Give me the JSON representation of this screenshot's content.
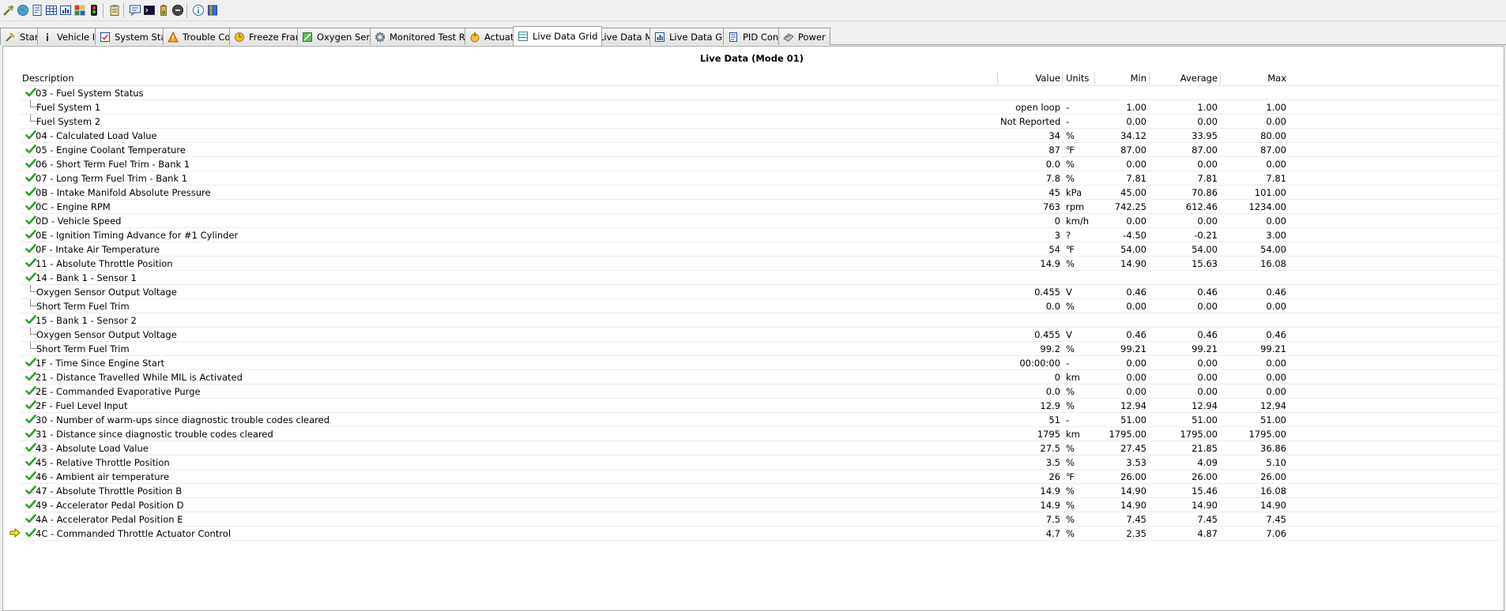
{
  "toolbar": {
    "icons": [
      "connect-icon",
      "globe-icon",
      "report-icon",
      "grid-icon",
      "table-icon",
      "chart-color-icon",
      "dollar-icon",
      "clipboard-icon",
      "chat-icon",
      "terminal-icon",
      "battery-icon",
      "stop-icon",
      "info-icon",
      "book-icon"
    ]
  },
  "tabs": [
    {
      "label": "Start",
      "icon": "start-icon"
    },
    {
      "label": "Vehicle Info",
      "icon": "info-icon"
    },
    {
      "label": "System Status",
      "icon": "status-icon"
    },
    {
      "label": "Trouble Codes",
      "icon": "warning-icon"
    },
    {
      "label": "Freeze Frames",
      "icon": "freeze-icon"
    },
    {
      "label": "Oxygen Sensors",
      "icon": "sensor-icon"
    },
    {
      "label": "Monitored Test Results",
      "icon": "gear-icon"
    },
    {
      "label": "Actuator",
      "icon": "actuator-icon"
    },
    {
      "label": "Live Data Grid",
      "icon": "grid-icon",
      "active": true
    },
    {
      "label": "Live Data Meter",
      "icon": "meter-icon"
    },
    {
      "label": "Live Data Graph",
      "icon": "graph-icon"
    },
    {
      "label": "PID Config",
      "icon": "config-icon"
    },
    {
      "label": "Power",
      "icon": "power-icon"
    }
  ],
  "grid": {
    "title": "Live Data (Mode 01)",
    "columns": {
      "description": "Description",
      "value": "Value",
      "units": "Units",
      "min": "Min",
      "average": "Average",
      "max": "Max"
    },
    "rows": [
      {
        "desc": "03 - Fuel System Status",
        "value": "",
        "units": "",
        "min": "",
        "avg": "",
        "max": "",
        "checked": true
      },
      {
        "desc": "Fuel System 1",
        "value": "open loop",
        "units": "-",
        "min": "1.00",
        "avg": "1.00",
        "max": "1.00",
        "child": true
      },
      {
        "desc": "Fuel System 2",
        "value": "Not Reported",
        "units": "-",
        "min": "0.00",
        "avg": "0.00",
        "max": "0.00",
        "child": true
      },
      {
        "desc": "04 - Calculated Load Value",
        "value": "34",
        "units": "%",
        "min": "34.12",
        "avg": "33.95",
        "max": "80.00",
        "checked": true
      },
      {
        "desc": "05 - Engine Coolant Temperature",
        "value": "87",
        "units": "℉",
        "min": "87.00",
        "avg": "87.00",
        "max": "87.00",
        "checked": true
      },
      {
        "desc": "06 - Short Term Fuel Trim - Bank 1",
        "value": "0.0",
        "units": "%",
        "min": "0.00",
        "avg": "0.00",
        "max": "0.00",
        "checked": true
      },
      {
        "desc": "07 - Long Term Fuel Trim - Bank 1",
        "value": "7.8",
        "units": "%",
        "min": "7.81",
        "avg": "7.81",
        "max": "7.81",
        "checked": true
      },
      {
        "desc": "0B - Intake Manifold Absolute Pressure",
        "value": "45",
        "units": "kPa",
        "min": "45.00",
        "avg": "70.86",
        "max": "101.00",
        "checked": true
      },
      {
        "desc": "0C - Engine RPM",
        "value": "763",
        "units": "rpm",
        "min": "742.25",
        "avg": "612.46",
        "max": "1234.00",
        "checked": true
      },
      {
        "desc": "0D - Vehicle Speed",
        "value": "0",
        "units": "km/h",
        "min": "0.00",
        "avg": "0.00",
        "max": "0.00",
        "checked": true
      },
      {
        "desc": "0E - Ignition Timing Advance for #1 Cylinder",
        "value": "3",
        "units": "?",
        "min": "-4.50",
        "avg": "-0.21",
        "max": "3.00",
        "checked": true
      },
      {
        "desc": "0F - Intake Air Temperature",
        "value": "54",
        "units": "℉",
        "min": "54.00",
        "avg": "54.00",
        "max": "54.00",
        "checked": true
      },
      {
        "desc": "11 - Absolute Throttle Position",
        "value": "14.9",
        "units": "%",
        "min": "14.90",
        "avg": "15.63",
        "max": "16.08",
        "checked": true
      },
      {
        "desc": "14 - Bank 1 - Sensor 1",
        "value": "",
        "units": "",
        "min": "",
        "avg": "",
        "max": "",
        "checked": true
      },
      {
        "desc": "Oxygen Sensor Output Voltage",
        "value": "0.455",
        "units": "V",
        "min": "0.46",
        "avg": "0.46",
        "max": "0.46",
        "child": true
      },
      {
        "desc": "Short Term Fuel Trim",
        "value": "0.0",
        "units": "%",
        "min": "0.00",
        "avg": "0.00",
        "max": "0.00",
        "child": true
      },
      {
        "desc": "15 - Bank 1 - Sensor 2",
        "value": "",
        "units": "",
        "min": "",
        "avg": "",
        "max": "",
        "checked": true
      },
      {
        "desc": "Oxygen Sensor Output Voltage",
        "value": "0.455",
        "units": "V",
        "min": "0.46",
        "avg": "0.46",
        "max": "0.46",
        "child": true
      },
      {
        "desc": "Short Term Fuel Trim",
        "value": "99.2",
        "units": "%",
        "min": "99.21",
        "avg": "99.21",
        "max": "99.21",
        "child": true
      },
      {
        "desc": "1F - Time Since Engine Start",
        "value": "00:00:00",
        "units": "-",
        "min": "0.00",
        "avg": "0.00",
        "max": "0.00",
        "checked": true
      },
      {
        "desc": "21 - Distance Travelled While MIL is Activated",
        "value": "0",
        "units": "km",
        "min": "0.00",
        "avg": "0.00",
        "max": "0.00",
        "checked": true
      },
      {
        "desc": "2E - Commanded Evaporative Purge",
        "value": "0.0",
        "units": "%",
        "min": "0.00",
        "avg": "0.00",
        "max": "0.00",
        "checked": true
      },
      {
        "desc": "2F - Fuel Level Input",
        "value": "12.9",
        "units": "%",
        "min": "12.94",
        "avg": "12.94",
        "max": "12.94",
        "checked": true
      },
      {
        "desc": "30 - Number of warm-ups since diagnostic trouble codes cleared",
        "value": "51",
        "units": "-",
        "min": "51.00",
        "avg": "51.00",
        "max": "51.00",
        "checked": true
      },
      {
        "desc": "31 - Distance since diagnostic trouble codes cleared",
        "value": "1795",
        "units": "km",
        "min": "1795.00",
        "avg": "1795.00",
        "max": "1795.00",
        "checked": true
      },
      {
        "desc": "43 - Absolute Load Value",
        "value": "27.5",
        "units": "%",
        "min": "27.45",
        "avg": "21.85",
        "max": "36.86",
        "checked": true
      },
      {
        "desc": "45 - Relative Throttle Position",
        "value": "3.5",
        "units": "%",
        "min": "3.53",
        "avg": "4.09",
        "max": "5.10",
        "checked": true
      },
      {
        "desc": "46 - Ambient air temperature",
        "value": "26",
        "units": "℉",
        "min": "26.00",
        "avg": "26.00",
        "max": "26.00",
        "checked": true
      },
      {
        "desc": "47 - Absolute Throttle Position B",
        "value": "14.9",
        "units": "%",
        "min": "14.90",
        "avg": "15.46",
        "max": "16.08",
        "checked": true
      },
      {
        "desc": "49 - Accelerator Pedal Position D",
        "value": "14.9",
        "units": "%",
        "min": "14.90",
        "avg": "14.90",
        "max": "14.90",
        "checked": true
      },
      {
        "desc": "4A - Accelerator Pedal Position E",
        "value": "7.5",
        "units": "%",
        "min": "7.45",
        "avg": "7.45",
        "max": "7.45",
        "checked": true
      },
      {
        "desc": "4C - Commanded Throttle Actuator Control",
        "value": "4.7",
        "units": "%",
        "min": "2.35",
        "avg": "4.87",
        "max": "7.06",
        "checked": true,
        "current": true
      }
    ]
  }
}
